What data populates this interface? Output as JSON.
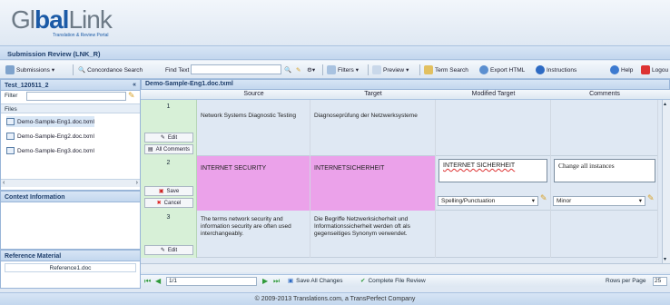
{
  "brand": {
    "name_a": "Gl",
    "name_b": "bal",
    "name_c": "Link",
    "tagline": "Translation & Review Portal"
  },
  "submission": {
    "title": "Submission Review (LNK_R)"
  },
  "toolbar": {
    "submissions": "Submissions",
    "concordance": "Concordance Search",
    "find_label": "Find Text",
    "find_value": "",
    "filters": "Filters",
    "preview": "Preview",
    "term_search": "Term Search",
    "export_html": "Export HTML",
    "instructions": "Instructions",
    "help": "Help",
    "logout": "Logou"
  },
  "left": {
    "project": "Test_120511_2",
    "collapse": "«",
    "filter_label": "Filter",
    "filter_value": "",
    "files_label": "Files",
    "files": [
      "Demo-Sample-Eng1.doc.txml",
      "Demo-Sample-Eng2.doc.txml",
      "Demo-Sample-Eng3.doc.txml"
    ],
    "context_title": "Context Information",
    "reference_title": "Reference Material",
    "reference_item": "Reference1.doc"
  },
  "grid": {
    "file_title": "Demo-Sample-Eng1.doc.txml",
    "columns": [
      "Source",
      "Target",
      "Modified Target",
      "Comments"
    ],
    "rows": [
      {
        "num": "1",
        "source": "Network Systems Diagnostic Testing",
        "target": "Diagnoseprüfung der Netzwerksysteme",
        "modified": "",
        "comment": "",
        "edit": "Edit",
        "all_comments": "All Comments"
      },
      {
        "num": "2",
        "source": "INTERNET SECURITY",
        "target": "INTERNETSICHERHEIT",
        "modified": "INTERNET SICHERHEIT",
        "comment": "Change all instances",
        "save": "Save",
        "cancel": "Cancel",
        "category": "Spelling/Punctuation",
        "severity": "Minor"
      },
      {
        "num": "3",
        "source": "The terms network security and information security are often used interchangeably.",
        "target": "Die Begriffe Netzwerksicherheit und Informationssicherheit werden oft als gegenseitiges Synonym verwendet.",
        "modified": "",
        "comment": "",
        "edit": "Edit"
      }
    ]
  },
  "pager": {
    "page": "1/1",
    "save_all": "Save All Changes",
    "complete": "Complete File Review",
    "rows_label": "Rows per Page",
    "rows_value": "25"
  },
  "footer": {
    "copyright": "© 2009-2013 Translations.com, a TransPerfect Company"
  }
}
